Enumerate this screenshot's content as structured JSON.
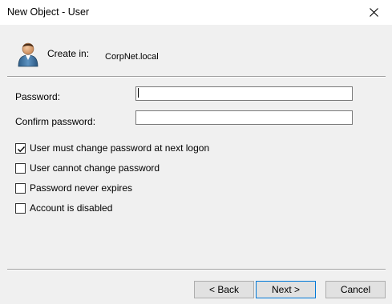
{
  "window": {
    "title": "New Object - User"
  },
  "header": {
    "icon": "user-icon",
    "create_in_label": "Create in:",
    "create_in_value": "CorpNet.local"
  },
  "form": {
    "password_label": "Password:",
    "password_value": "",
    "confirm_label": "Confirm password:",
    "confirm_value": ""
  },
  "options": [
    {
      "label": "User must change password at next logon",
      "checked": true
    },
    {
      "label": "User cannot change password",
      "checked": false
    },
    {
      "label": "Password never expires",
      "checked": false
    },
    {
      "label": "Account is disabled",
      "checked": false
    }
  ],
  "buttons": {
    "back": "< Back",
    "next": "Next >",
    "cancel": "Cancel"
  },
  "colors": {
    "accent": "#0078d7",
    "background": "#f0f0f0"
  }
}
